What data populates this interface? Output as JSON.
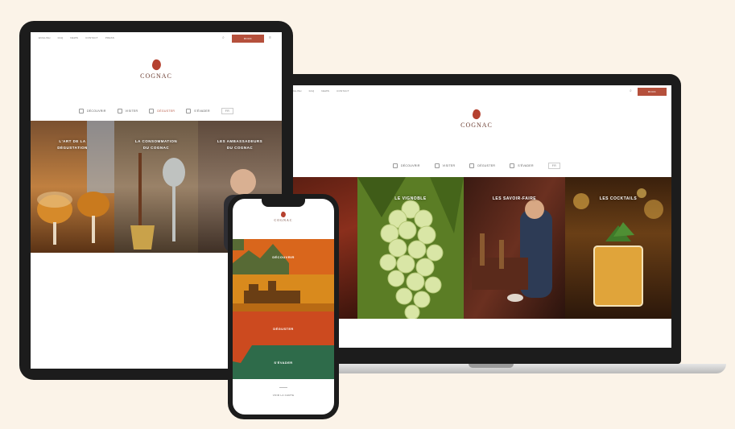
{
  "colors": {
    "background": "#fbf3e8",
    "brand": "#b5503c",
    "panel_orange": "#d9661c",
    "panel_amber": "#d98a1d",
    "panel_red": "#cc4a1f",
    "panel_green": "#2e6b4a"
  },
  "tablet": {
    "topbar_links": [
      "ENGLISH",
      "FAQ",
      "NEWS",
      "CONTACT",
      "PRESS"
    ],
    "cta_label": "BOOK",
    "logo_word": "COGNAC",
    "logo_sub": "",
    "nav": [
      {
        "label": "DÉCOUVRIR",
        "icon": "compass-icon"
      },
      {
        "label": "VISITER",
        "icon": "map-icon"
      },
      {
        "label": "DÉGUSTER",
        "icon": "glass-icon",
        "active": true
      },
      {
        "label": "S'ÉVADER",
        "icon": "leaf-icon"
      }
    ],
    "lang_label": "FR",
    "tiles": [
      {
        "title_line1": "L'ART DE LA",
        "title_line2": "DÉGUSTATION"
      },
      {
        "title_line1": "LA CONSOMMATION",
        "title_line2": "DU COGNAC"
      },
      {
        "title_line1": "LES AMBASSADEURS",
        "title_line2": "DU COGNAC"
      }
    ]
  },
  "laptop": {
    "topbar_links": [
      "ENGLISH",
      "FAQ",
      "NEWS",
      "CONTACT"
    ],
    "cta_label": "BOOK",
    "logo_word": "COGNAC",
    "logo_sub": "",
    "nav": [
      {
        "label": "DÉCOUVRIR",
        "icon": "compass-icon"
      },
      {
        "label": "VISITER",
        "icon": "map-icon"
      },
      {
        "label": "DÉGUSTER",
        "icon": "glass-icon"
      },
      {
        "label": "S'ÉVADER",
        "icon": "leaf-icon"
      }
    ],
    "lang_label": "FR",
    "tiles": [
      {
        "title": ""
      },
      {
        "title": "LE VIGNOBLE"
      },
      {
        "title": "LES SAVOIR-FAIRE"
      },
      {
        "title": "LES COCKTAILS"
      }
    ]
  },
  "phone": {
    "logo_word": "COGNAC",
    "panels": [
      {
        "label": "DÉCOUVRIR"
      },
      {
        "label": ""
      },
      {
        "label": "DÉGUSTER"
      },
      {
        "label": "S'ÉVADER"
      }
    ],
    "footer_label": "VOIR LA CARTE"
  }
}
